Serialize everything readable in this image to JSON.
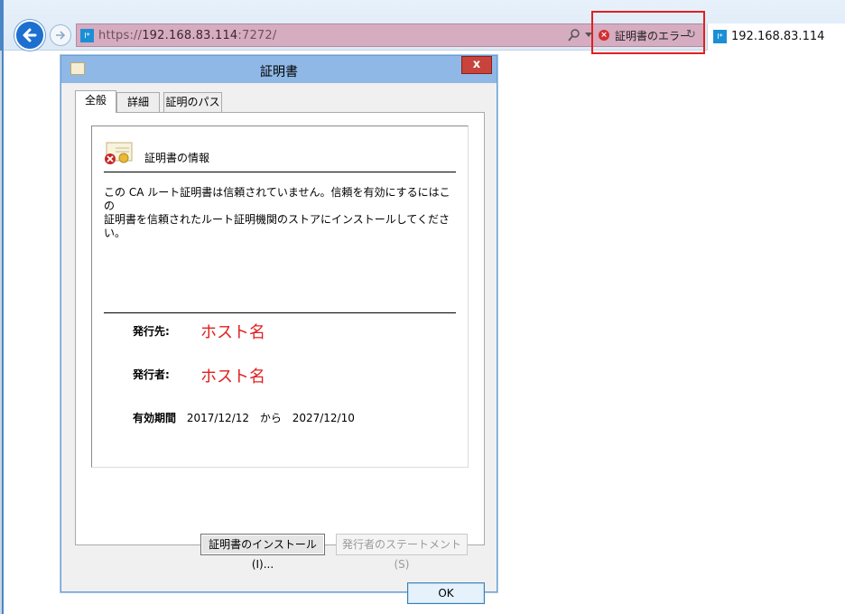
{
  "browser": {
    "url_scheme": "https://",
    "url_host": "192.168.83.114",
    "url_port": ":7272/",
    "cert_error_label": "証明書のエラー",
    "tab_title": "192.168.83.114",
    "site_icon_text": "I*"
  },
  "dialog": {
    "title": "証明書",
    "close_label": "x",
    "tabs": [
      {
        "label": "全般"
      },
      {
        "label": "詳細"
      },
      {
        "label": "証明のパス"
      }
    ],
    "info_title": "証明書の情報",
    "message_line1": "この CA ルート証明書は信頼されていません。信頼を有効にするにはこの",
    "message_line2": "証明書を信頼されたルート証明機関のストアにインストールしてください。",
    "issued_to_label": "発行先:",
    "issued_to_value": "ホスト名",
    "issued_by_label": "発行者:",
    "issued_by_value": "ホスト名",
    "validity_label": "有効期間",
    "valid_from": "2017/12/12",
    "valid_sep": "から",
    "valid_to": "2027/12/10",
    "install_button": "証明書のインストール(I)...",
    "issuer_statement_button": "発行者のステートメント(S)",
    "ok_button": "OK"
  },
  "colors": {
    "error_red": "#e02020",
    "address_bar": "#d6acc0",
    "titlebar": "#8fb8e6",
    "close_button": "#c7433b"
  }
}
